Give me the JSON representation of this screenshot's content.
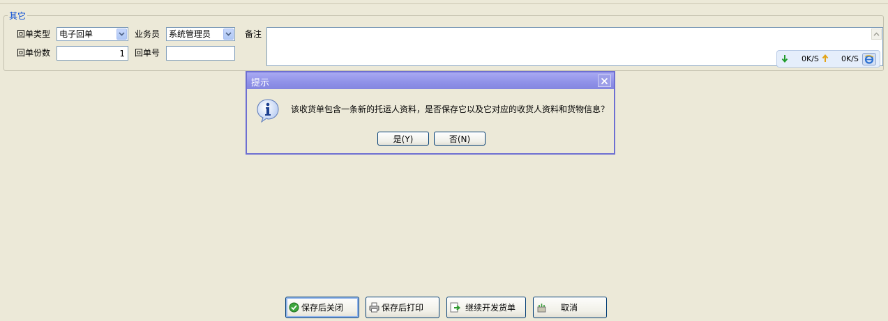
{
  "group": {
    "title": "其它"
  },
  "form": {
    "receipt_type_label": "回单类型",
    "receipt_type_value": "电子回单",
    "salesman_label": "业务员",
    "salesman_value": "系统管理员",
    "remark_label": "备注",
    "receipt_copies_label": "回单份数",
    "receipt_copies_value": "1",
    "receipt_no_label": "回单号",
    "receipt_no_value": ""
  },
  "netbar": {
    "down": "0K/S",
    "up": "0K/S"
  },
  "dialog": {
    "title": "提示",
    "message": "该收货单包含一条新的托运人资料，是否保存它以及它对应的收货人资料和货物信息？",
    "yes_label": "是(Y)",
    "no_label": "否(N)"
  },
  "actions": {
    "save_close": "保存后关闭",
    "save_print": "保存后打印",
    "continue": "继续开发货单",
    "cancel": "取消"
  },
  "colors": {
    "group_title": "#0046d5",
    "dialog_border": "#6d6fd2",
    "background": "#ece9d8"
  },
  "icons": [
    "chevron-down-icon",
    "scroll-up-icon",
    "arrow-down-icon",
    "arrow-up-icon",
    "ie-icon",
    "info-icon",
    "close-icon",
    "check-icon",
    "printer-icon",
    "continue-icon",
    "cancel-icon"
  ]
}
